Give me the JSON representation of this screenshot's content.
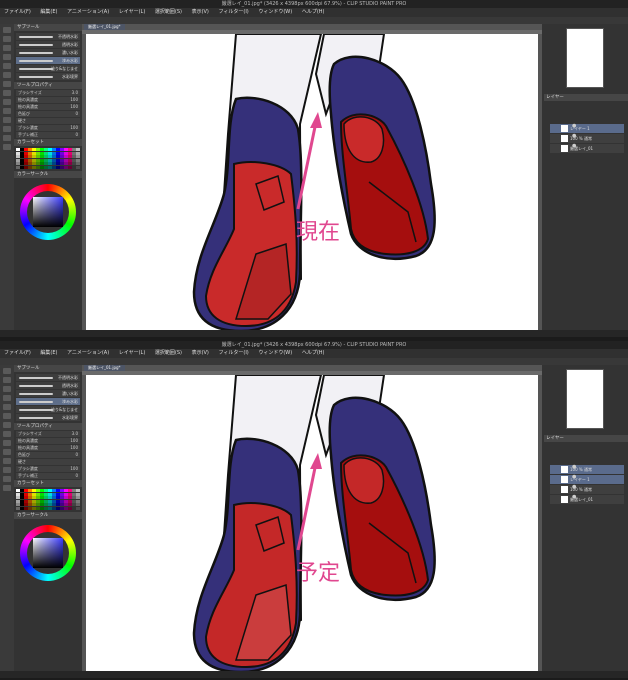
{
  "window": {
    "title": "厳選レイ_01.jpg* (3426 x 4398px 600dpi 67.9%) - CLIP STUDIO PAINT PRO",
    "canvas_tab": "厳選レイ_01.jpg*"
  },
  "menu": [
    "ファイル(F)",
    "編集(E)",
    "アニメーション(A)",
    "レイヤー(L)",
    "選択範囲(S)",
    "表示(V)",
    "フィルター(I)",
    "ウィンドウ(W)",
    "ヘルプ(H)"
  ],
  "panels": {
    "subtool_title": "サブツール",
    "brushes": [
      "不透明水彩",
      "透明水彩",
      "濃い水彩",
      "滲み水彩",
      "塗り&なじませ",
      "水彩境界"
    ],
    "tool_property_title": "ツールプロパティ",
    "properties": [
      {
        "label": "ブラシサイズ",
        "value": "3.0"
      },
      {
        "label": "絵の具濃度",
        "value": "100"
      },
      {
        "label": "絵の具濃度",
        "value": "100"
      },
      {
        "label": "色延び",
        "value": "0"
      },
      {
        "label": "硬さ",
        "value": ""
      },
      {
        "label": "ブラシ濃度",
        "value": "100"
      },
      {
        "label": "手ブレ補正",
        "value": "0"
      }
    ],
    "color_set_title": "カラーセット",
    "color_wheel_title": "カラーサークル",
    "layer_title": "レイヤー"
  },
  "layers": {
    "top": [
      {
        "name": "レイヤー 1",
        "selected": true
      },
      {
        "name": "100 % 通常",
        "selected": false
      },
      {
        "name": "厳選レイ_01",
        "selected": false
      }
    ],
    "bottom": [
      {
        "name": "100 % 通常",
        "selected": true
      },
      {
        "name": "レイヤー 1",
        "selected": true
      },
      {
        "name": "100 % 通常",
        "selected": false
      },
      {
        "name": "厳選レイ_01",
        "selected": false
      }
    ]
  },
  "annotations": {
    "top_label": "現在",
    "bottom_label": "予定",
    "arrow_color": "#e0478f"
  },
  "colors": {
    "shoe_blue": "#35307a",
    "sole_red_current": "#c92a2a",
    "sole_red_planned": "#c42828",
    "sole_dark_red": "#a50e0e",
    "sock": "#f2f1f5",
    "ui_dark": "#2b2b2b"
  },
  "palette_colors": [
    "#ffffff",
    "#000000",
    "#ff0000",
    "#ff8000",
    "#ffff00",
    "#80ff00",
    "#00ff00",
    "#00ff80",
    "#00ffff",
    "#0080ff",
    "#0000ff",
    "#8000ff",
    "#ff00ff",
    "#ff0080",
    "#808080",
    "#c0c0c0"
  ]
}
